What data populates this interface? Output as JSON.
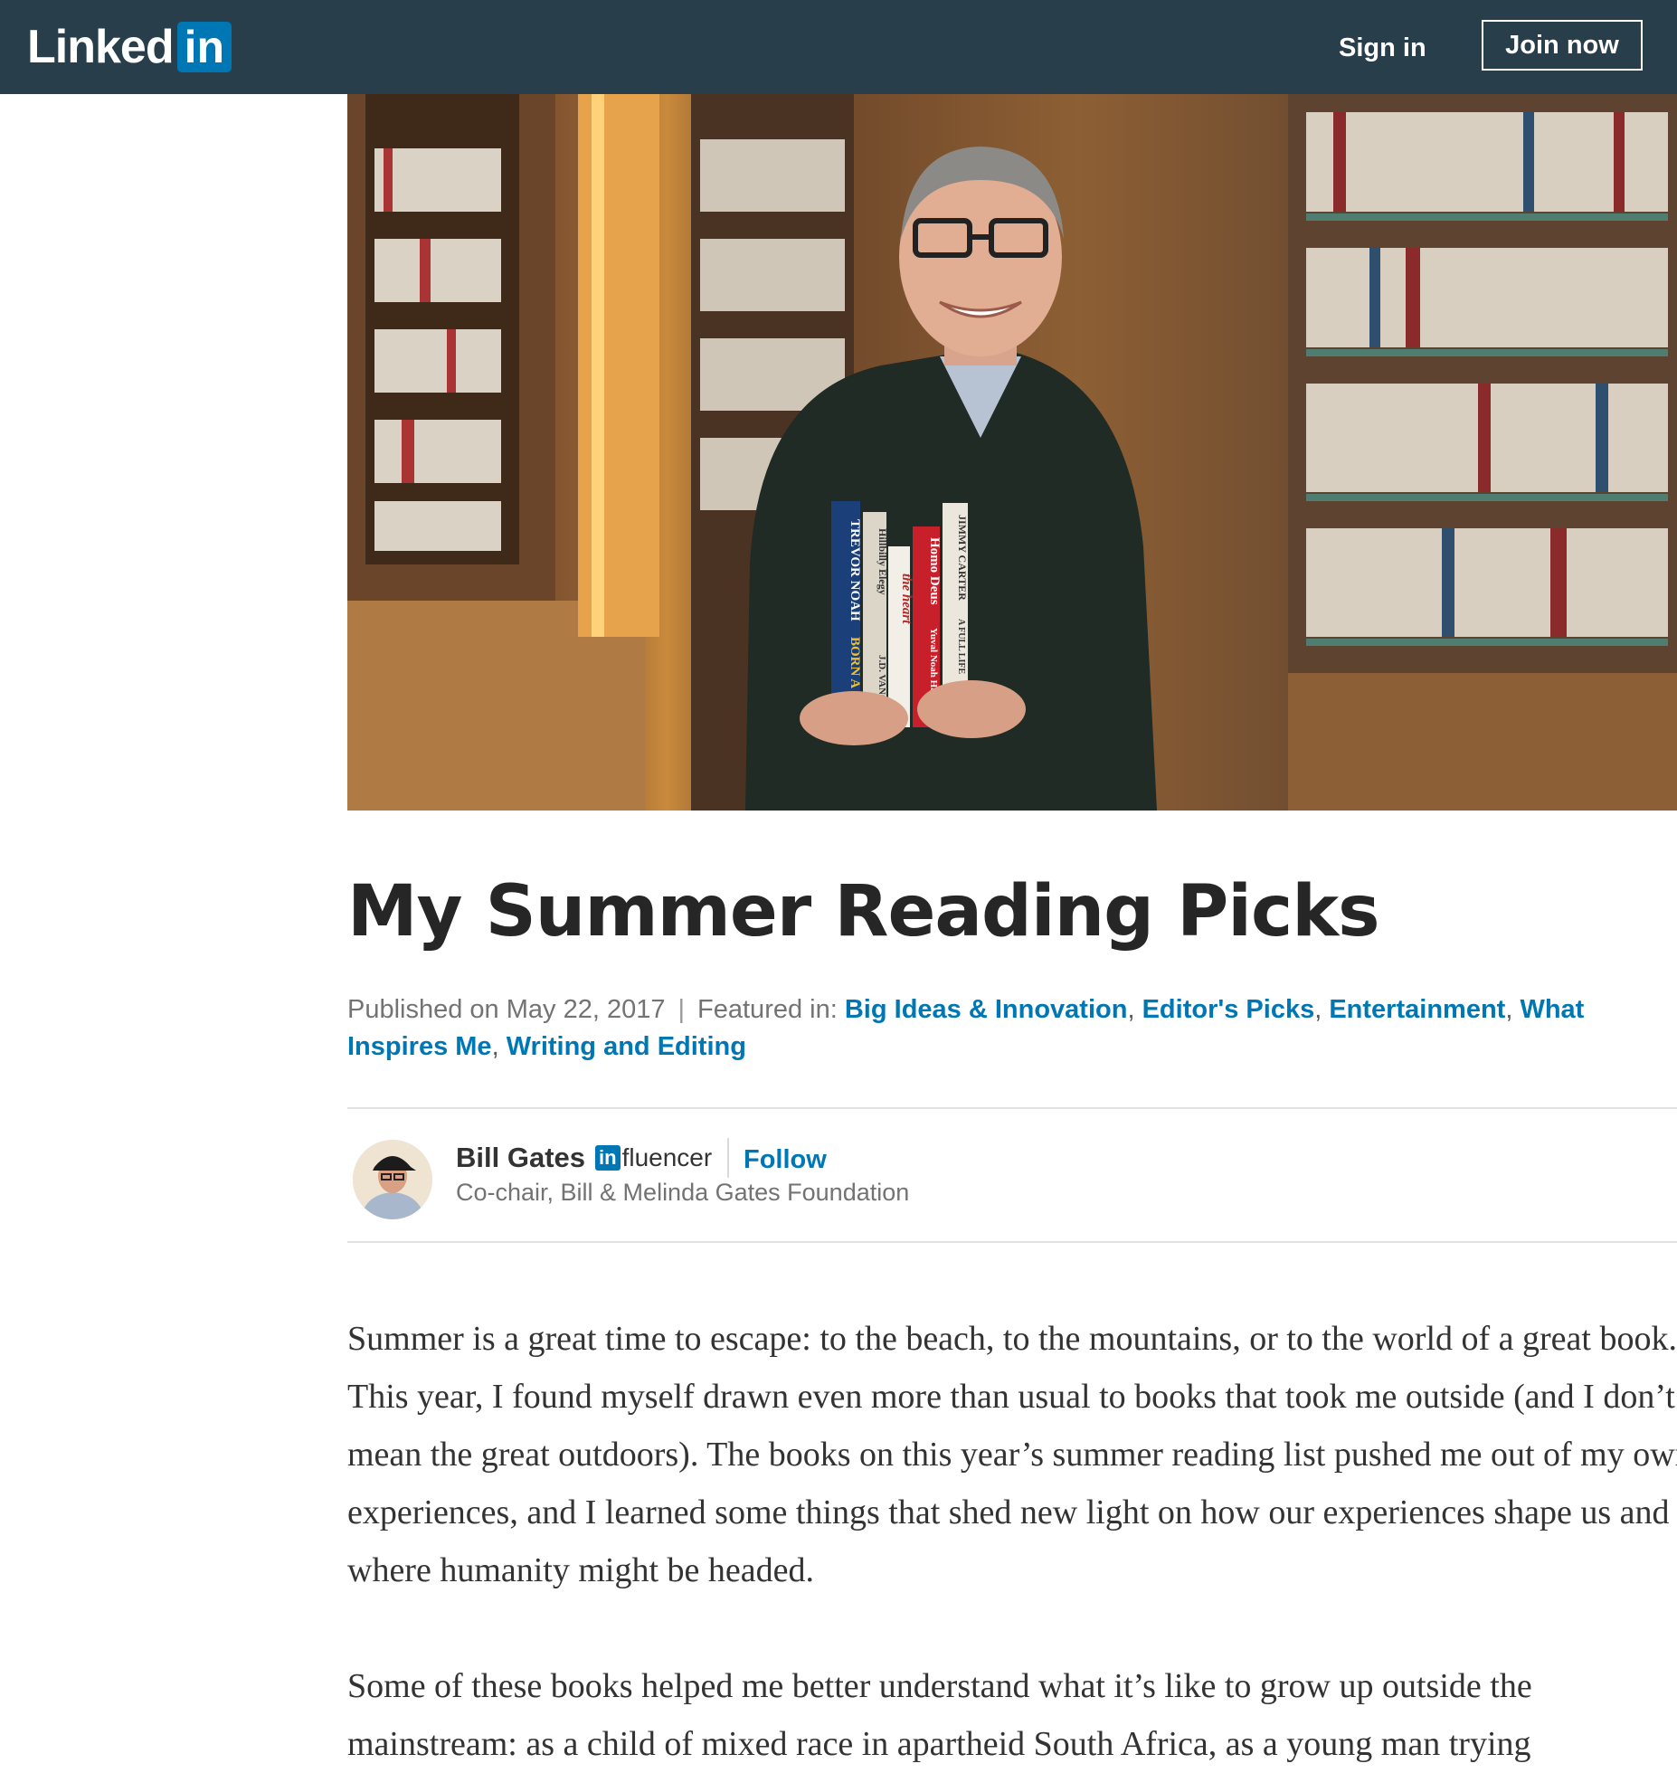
{
  "nav": {
    "logo_word": "Linked",
    "logo_box": "in",
    "signin_label": "Sign in",
    "join_label": "Join now",
    "bg_color": "#283e4a",
    "brand_color": "#0077b5"
  },
  "hero": {
    "book_spines": [
      "TREVOR NOAH",
      "BORN A CRIME",
      "Hillbilly Elegy",
      "J.D. VANCE",
      "the heart",
      "Homo Deus",
      "Yuval Noah Harari",
      "JIMMY CARTER",
      "A FULL LIFE"
    ]
  },
  "article": {
    "title": "My Summer Reading Picks",
    "published": "Published on May 22, 2017",
    "separator": "|",
    "featured_label": "Featured in:",
    "featured_tags": [
      "Big Ideas & Innovation",
      "Editor's Picks",
      "Entertainment",
      "What Inspires Me",
      "Writing and Editing"
    ],
    "comma": ","
  },
  "author": {
    "name": "Bill Gates",
    "badge_box": "in",
    "badge_word": "fluencer",
    "follow_label": "Follow",
    "role": "Co-chair, Bill & Melinda Gates Foundation"
  },
  "body": {
    "paragraphs": [
      "Summer is a great time to escape: to the beach, to the mountains, or to the world of a great book. This year, I found myself drawn even more than usual to books that took me outside (and I don’t mean the great outdoors). The books on this year’s summer reading list pushed me out of my own experiences, and I learned some things that shed new light on how our experiences shape us and where humanity might be headed.",
      "Some of these books helped me better understand what it’s like to grow up outside the mainstream: as a child of mixed race in apartheid South Africa, as a young man trying"
    ]
  }
}
